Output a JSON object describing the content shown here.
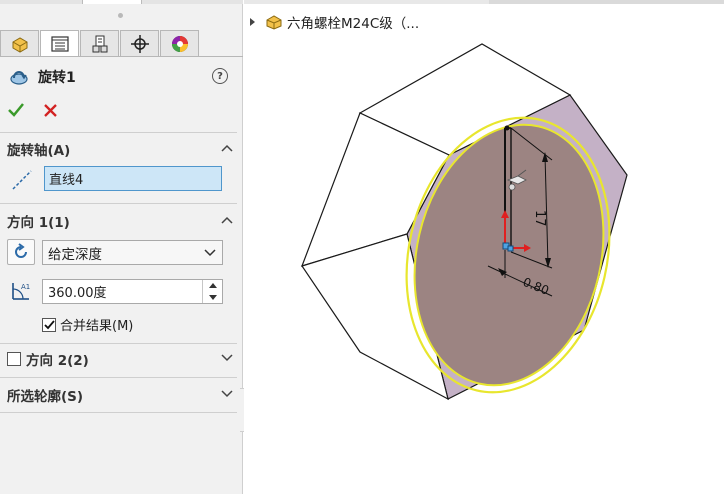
{
  "property_manager": {
    "feature_title": "旋转1",
    "help_label": "?",
    "tabs": [
      {
        "icon": "feature-manager-icon"
      },
      {
        "icon": "property-manager-icon"
      },
      {
        "icon": "configuration-manager-icon"
      },
      {
        "icon": "dimxpert-manager-icon"
      },
      {
        "icon": "display-manager-icon"
      }
    ],
    "ok_icon": "check-icon",
    "cancel_icon": "close-icon",
    "axis_section": {
      "title": "旋转轴(A)",
      "value": "直线4"
    },
    "direction1": {
      "title": "方向 1(1)",
      "end_condition": "给定深度",
      "angle": "360.00度",
      "merge_result_label": "合并结果(M)",
      "merge_result_checked": true
    },
    "direction2": {
      "title": "方向 2(2)",
      "checked": false
    },
    "selected_contours": {
      "title": "所选轮廓(S)"
    }
  },
  "feature_tree": {
    "part_name": "六角螺栓M24C级（..."
  },
  "sketch": {
    "dim_vertical": "17",
    "dim_horizontal": "0.80"
  },
  "colors": {
    "face_purple": "#c4b1c6",
    "face_sketch": "#9c8482",
    "highlight_yellow": "#e8e62e",
    "accent_blue": "#4f96cc",
    "ok_green": "#3a9a2a",
    "cancel_red": "#d22222"
  }
}
